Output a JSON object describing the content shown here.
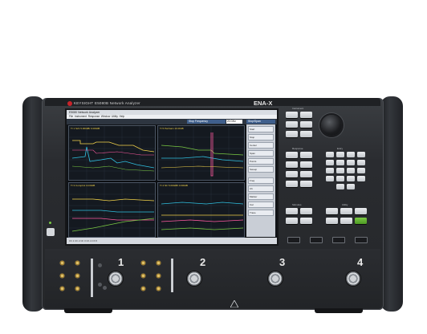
{
  "header": {
    "brand": "KEYSIGHT",
    "product": "E5080B Network Analyzer",
    "model": "ENA-X"
  },
  "screen": {
    "window_title": "E5080 Network Analyzer",
    "menu": [
      "File",
      "Instrument",
      "Response",
      "Window",
      "Utility",
      "Help"
    ],
    "stop_label": "Stop Frequency",
    "stop_value": "20 GHz",
    "softkey_header": "Stop/Span",
    "softkeys": [
      "Start",
      "Stop",
      "Center",
      "Span",
      "Points",
      "Sweep",
      "Freq",
      "Ch",
      "Marker",
      "Cal",
      "Trace"
    ],
    "plot_labels": [
      "Tr 1  S21  5.000dB/ 0.000dB",
      "Tr 5  PwrGain  10.00dB",
      "Tr 3  CompIn1  10.00dB",
      "Tr 4  NF  5.000dB/ 0.000dB"
    ],
    "status": "Ch 1    Ch 2    Ch 3    Ch 4    Ch 5"
  },
  "panel": {
    "instrument": "Instrument",
    "response": "Response",
    "stimulus": "Stimulus",
    "utility": "Utility",
    "entry": "Entry"
  },
  "ports": {
    "labels": [
      "1",
      "2",
      "3",
      "4"
    ]
  }
}
